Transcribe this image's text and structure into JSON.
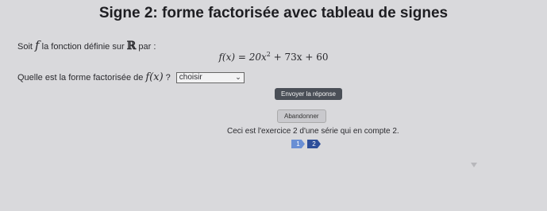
{
  "title": "Signe 2: forme factorisée avec tableau de signes",
  "statement": {
    "prefix": "Soit",
    "var": "f",
    "middle": "la fonction définie sur",
    "domain": "ℝ",
    "suffix": "par :"
  },
  "formula": {
    "lhs": "f(x) = 20x",
    "exp": "2",
    "rhs": "+ 73x + 60"
  },
  "question": {
    "prefix": "Quelle est la forme factorisée de",
    "expr": "f(x)",
    "suffix": "?",
    "select_value": "choisir"
  },
  "buttons": {
    "submit": "Envoyer la réponse",
    "abort": "Abandonner"
  },
  "info": "Ceci est l'exercice 2 d'une série qui en compte 2.",
  "pager": [
    "1",
    "2"
  ]
}
